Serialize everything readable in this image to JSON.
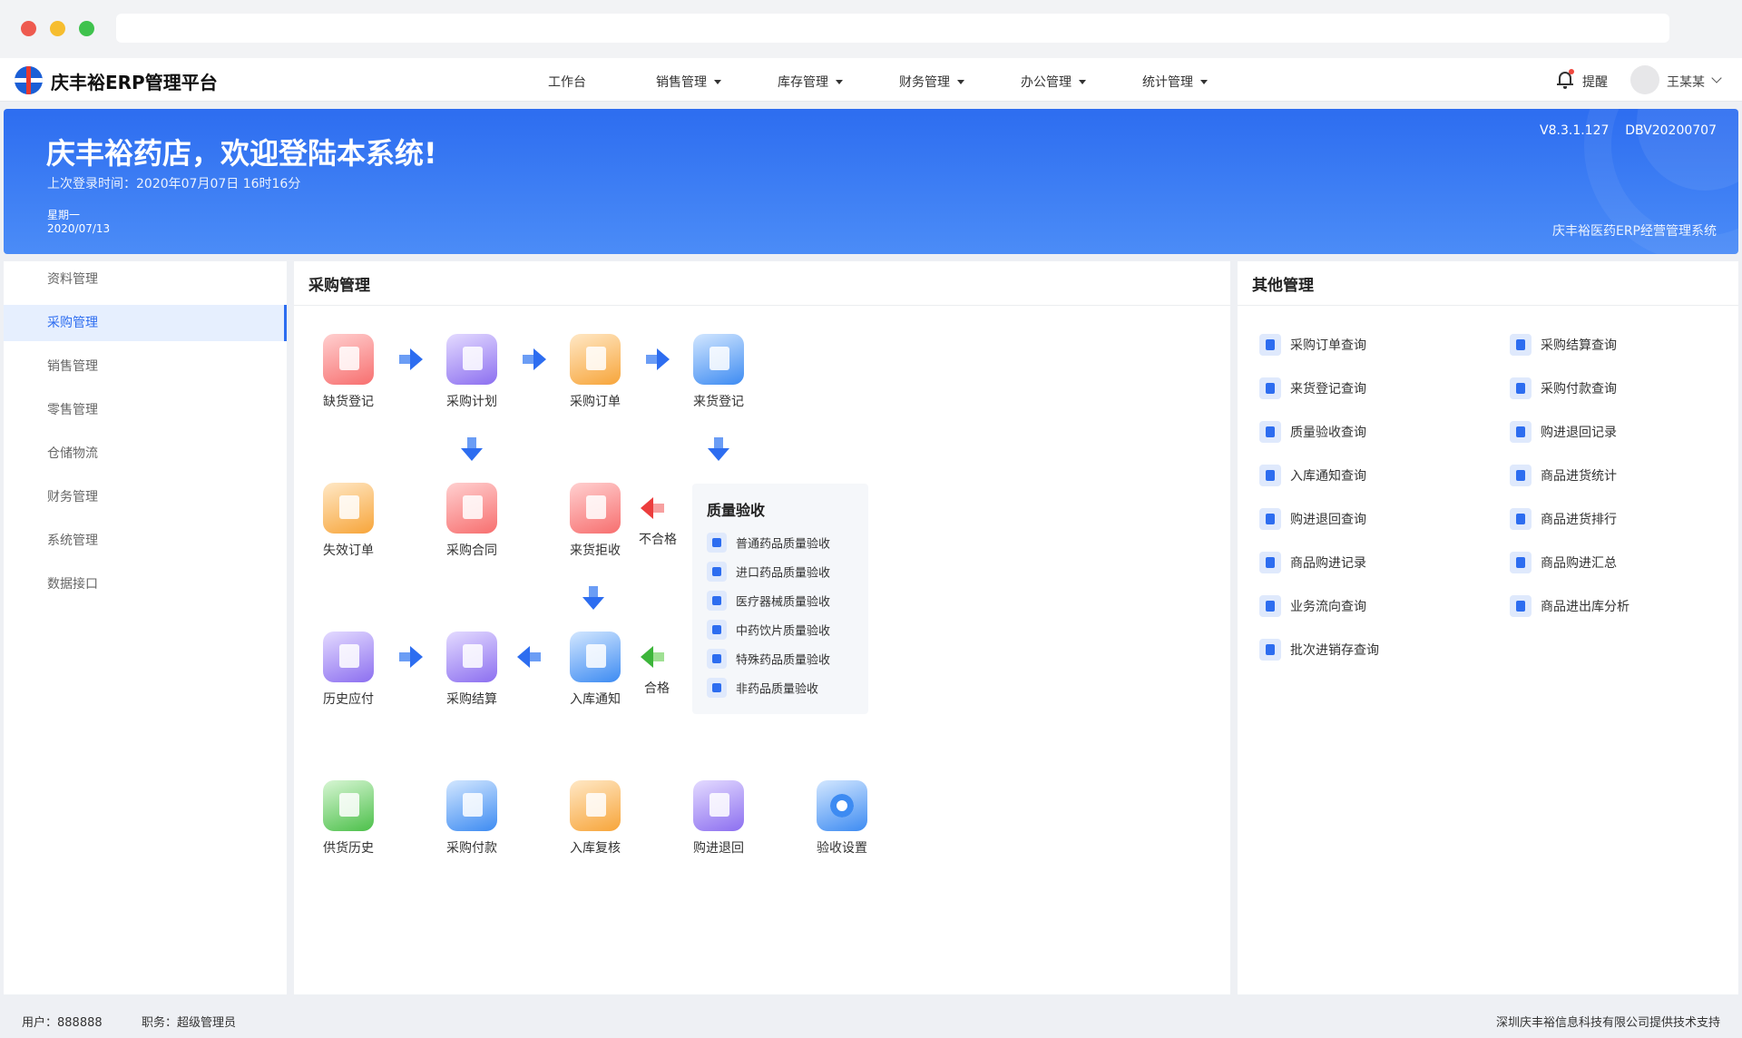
{
  "app": {
    "brand": "庆丰裕ERP管理平台",
    "accent_color": "#2d6df0"
  },
  "nav": {
    "items": [
      {
        "label": "工作台"
      },
      {
        "label": "销售管理"
      },
      {
        "label": "库存管理"
      },
      {
        "label": "财务管理"
      },
      {
        "label": "办公管理"
      },
      {
        "label": "统计管理"
      }
    ],
    "remind_label": "提醒",
    "user_name": "王某某"
  },
  "banner": {
    "welcome": "庆丰裕药店，欢迎登陆本系统!",
    "last_login": "上次登录时间：2020年07月07日 16时16分",
    "weekday": "星期一",
    "date": "2020/07/13",
    "version": "V8.3.1.127    DBV20200707",
    "system_name": "庆丰裕医药ERP经营管理系统"
  },
  "sidebar": {
    "items": [
      {
        "label": "资料管理"
      },
      {
        "label": "采购管理",
        "active": true
      },
      {
        "label": "销售管理"
      },
      {
        "label": "零售管理"
      },
      {
        "label": "仓储物流"
      },
      {
        "label": "财务管理"
      },
      {
        "label": "系统管理"
      },
      {
        "label": "数据接口"
      }
    ]
  },
  "purchase": {
    "title": "采购管理",
    "nodes": [
      {
        "label": "缺货登记",
        "icon": "shortage-register-icon"
      },
      {
        "label": "采购计划",
        "icon": "purchase-plan-icon"
      },
      {
        "label": "采购订单",
        "icon": "purchase-order-icon"
      },
      {
        "label": "来货登记",
        "icon": "arrival-register-icon"
      },
      {
        "label": "失效订单",
        "icon": "expired-order-icon"
      },
      {
        "label": "采购合同",
        "icon": "purchase-contract-icon"
      },
      {
        "label": "来货拒收",
        "icon": "arrival-reject-icon"
      },
      {
        "label": "历史应付",
        "icon": "history-payable-icon"
      },
      {
        "label": "采购结算",
        "icon": "purchase-settlement-icon"
      },
      {
        "label": "入库通知",
        "icon": "storage-notice-icon"
      },
      {
        "label": "供货历史",
        "icon": "supply-history-icon"
      },
      {
        "label": "采购付款",
        "icon": "purchase-payment-icon"
      },
      {
        "label": "入库复核",
        "icon": "storage-recheck-icon"
      },
      {
        "label": "购进退回",
        "icon": "purchase-return-icon"
      },
      {
        "label": "验收设置",
        "icon": "acceptance-settings-icon"
      }
    ],
    "unqualified_label": "不合格",
    "qualified_label": "合格",
    "quality": {
      "title": "质量验收",
      "items": [
        {
          "label": "普通药品质量验收"
        },
        {
          "label": "进口药品质量验收"
        },
        {
          "label": "医疗器械质量验收"
        },
        {
          "label": "中药饮片质量验收"
        },
        {
          "label": "特殊药品质量验收"
        },
        {
          "label": "非药品质量验收"
        }
      ]
    }
  },
  "other": {
    "title": "其他管理",
    "items": [
      {
        "label": "采购订单查询"
      },
      {
        "label": "采购结算查询"
      },
      {
        "label": "来货登记查询"
      },
      {
        "label": "采购付款查询"
      },
      {
        "label": "质量验收查询"
      },
      {
        "label": "购进退回记录"
      },
      {
        "label": "入库通知查询"
      },
      {
        "label": "商品进货统计"
      },
      {
        "label": "购进退回查询"
      },
      {
        "label": "商品进货排行"
      },
      {
        "label": "商品购进记录"
      },
      {
        "label": "商品购进汇总"
      },
      {
        "label": "业务流向查询"
      },
      {
        "label": "商品进出库分析"
      },
      {
        "label": "批次进销存查询"
      }
    ]
  },
  "footer": {
    "user": "用户：888888",
    "role": "职务：超级管理员",
    "support": "深圳庆丰裕信息科技有限公司提供技术支持"
  }
}
